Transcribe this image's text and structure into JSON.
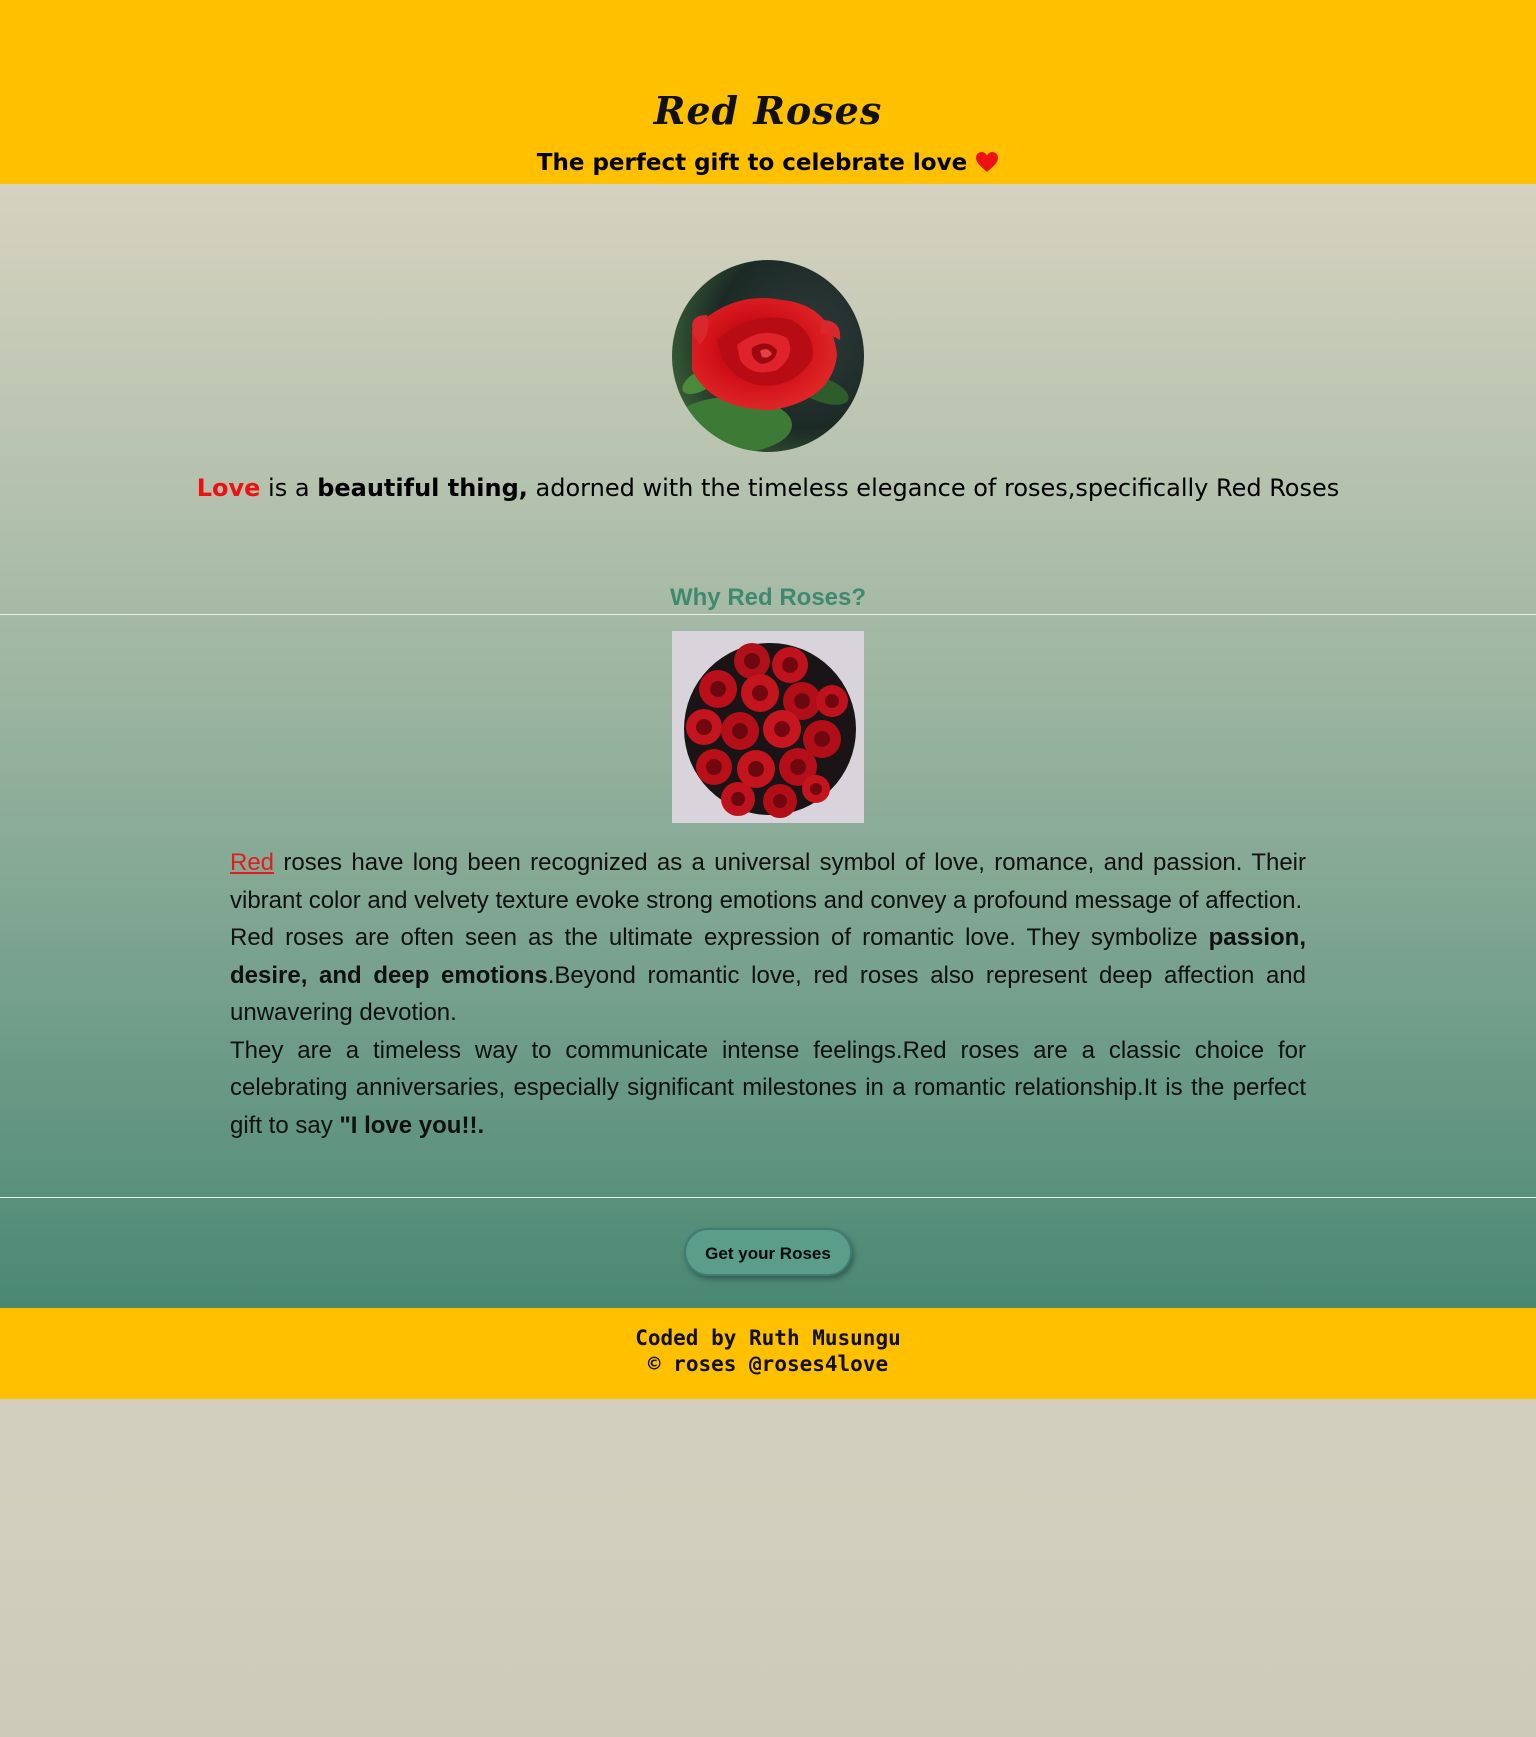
{
  "header": {
    "title": "Red Roses",
    "subtitle": "The perfect gift to celebrate love",
    "heart_icon": "heart-icon",
    "background": "#ffc000"
  },
  "hero": {
    "image": "red-rose-image",
    "intro": {
      "love": "Love",
      "is_a": " is a ",
      "beautiful": "beautiful thing,",
      "rest": " adorned with the timeless elegance of roses,specifically Red Roses"
    }
  },
  "why": {
    "heading": "Why Red Roses?",
    "image": "rose-bouquet-image",
    "p1": {
      "link": "Red",
      "text": " roses have long been recognized as a universal symbol of love, romance, and passion. Their vibrant color and velvety texture evoke strong emotions and convey a profound message of affection."
    },
    "p2": {
      "text_a": "Red roses are often seen as the ultimate expression of romantic love. They symbolize ",
      "bold": "passion, desire, and deep emotions",
      "text_b": ".Beyond romantic love, red roses also represent deep affection and unwavering devotion."
    },
    "p3": {
      "text": "They are a timeless way to communicate intense feelings.Red roses are a classic choice for celebrating anniversaries, especially significant milestones in a romantic relationship.It is the perfect gift to say ",
      "bold": "\"I love you!!."
    }
  },
  "cta": {
    "label": "Get your Roses"
  },
  "footer": {
    "credit": "Coded by Ruth Musungu",
    "copyright": "© roses @roses4love",
    "background": "#ffc000"
  },
  "colors": {
    "accent_red": "#ee1111",
    "heading_green": "#3f8a6e"
  }
}
